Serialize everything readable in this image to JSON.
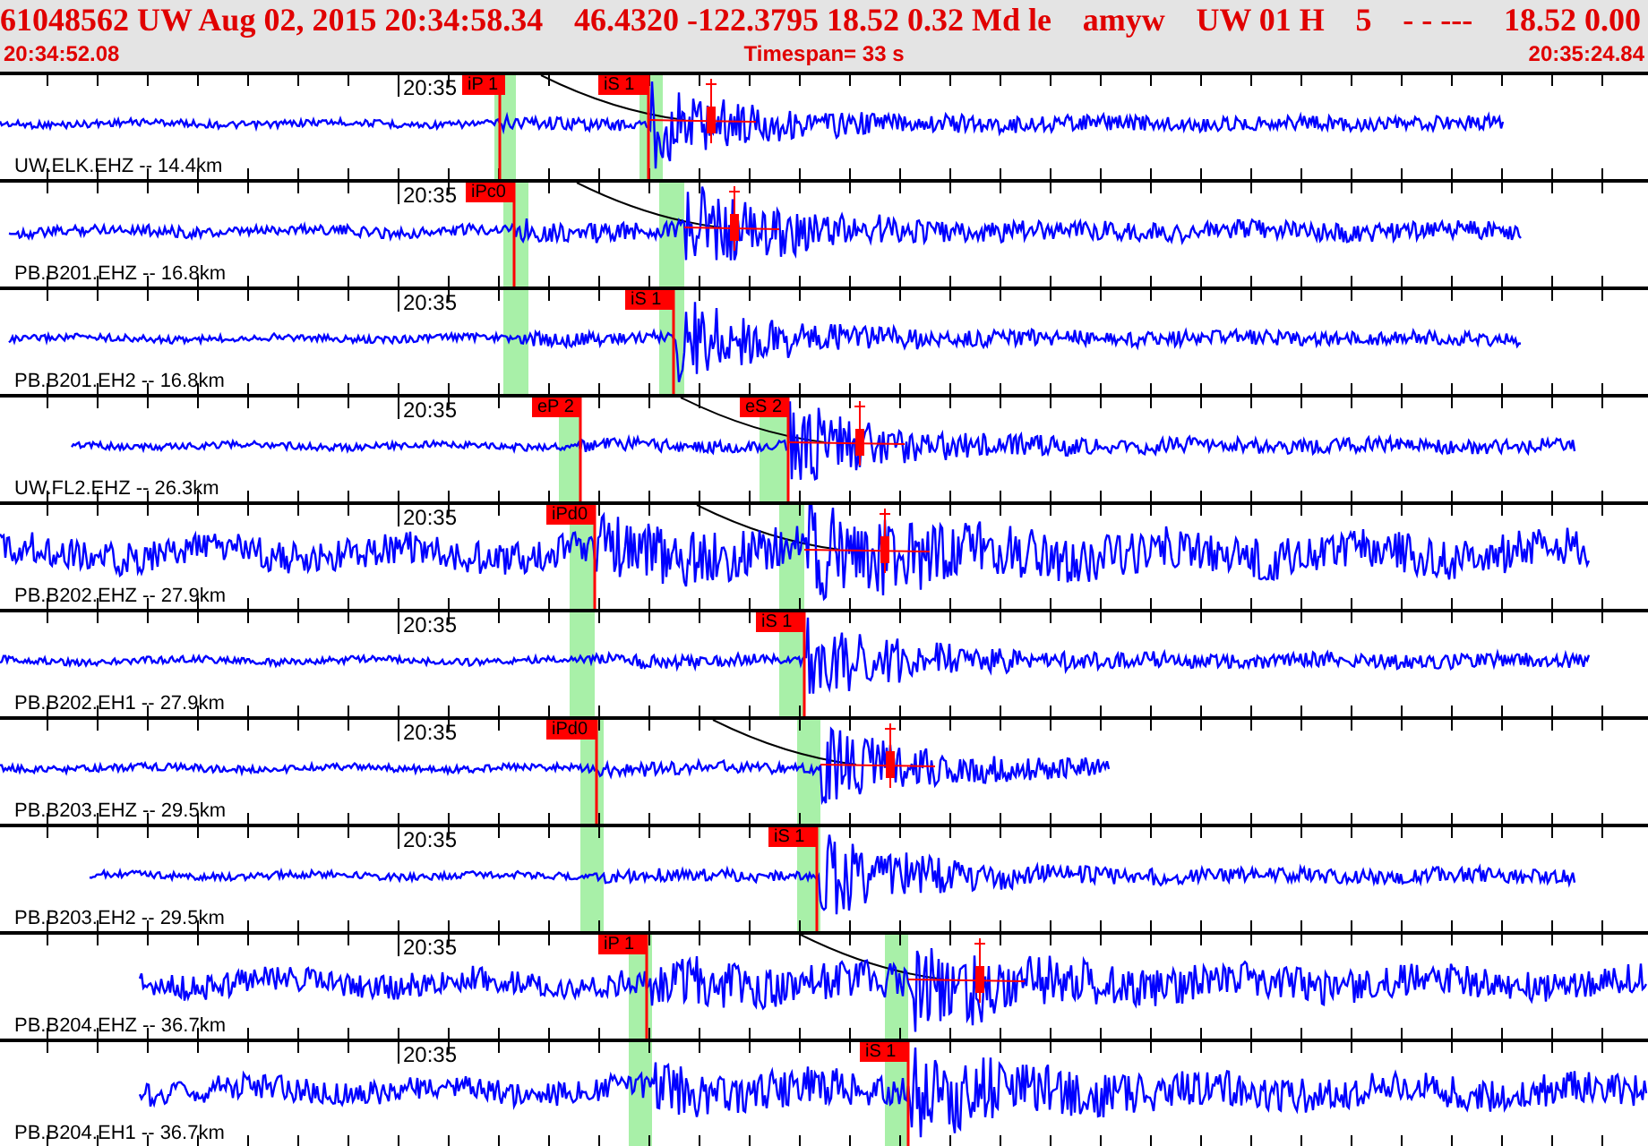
{
  "header": {
    "event_fields": [
      "61048562 UW Aug 02, 2015 20:34:58.34",
      "46.4320 -122.3795 18.52 0.32 Md le",
      "amyw",
      "UW 01 H",
      "5",
      "- - ---",
      "18.52 0.00"
    ],
    "start_time": "20:34:52.08",
    "timespan": "Timespan=  33 s",
    "end_time": "20:35:24.84"
  },
  "traces": [
    {
      "station": "UW.ELK.EHZ -- 14.4km",
      "time_label": "20:35",
      "picks": [
        {
          "label": "iP 1"
        },
        {
          "label": "iS 1"
        }
      ]
    },
    {
      "station": "PB.B201.EHZ -- 16.8km",
      "time_label": "20:35",
      "picks": [
        {
          "label": "iPc0"
        }
      ]
    },
    {
      "station": "PB.B201.EH2 -- 16.8km",
      "time_label": "20:35",
      "picks": [
        {
          "label": "iS 1"
        }
      ]
    },
    {
      "station": "UW.FL2.EHZ -- 26.3km",
      "time_label": "20:35",
      "picks": [
        {
          "label": "eP 2"
        },
        {
          "label": "eS 2"
        }
      ]
    },
    {
      "station": "PB.B202.EHZ -- 27.9km",
      "time_label": "20:35",
      "picks": [
        {
          "label": "iPd0"
        }
      ]
    },
    {
      "station": "PB.B202.EH1 -- 27.9km",
      "time_label": "20:35",
      "picks": [
        {
          "label": "iS 1"
        }
      ]
    },
    {
      "station": "PB.B203.EHZ -- 29.5km",
      "time_label": "20:35",
      "picks": [
        {
          "label": "iPd0"
        }
      ]
    },
    {
      "station": "PB.B203.EH2 -- 29.5km",
      "time_label": "20:35",
      "picks": [
        {
          "label": "iS 1"
        }
      ]
    },
    {
      "station": "PB.B204.EHZ -- 36.7km",
      "time_label": "20:35",
      "picks": [
        {
          "label": "iP 1"
        }
      ]
    },
    {
      "station": "PB.B204.EH1 -- 36.7km",
      "time_label": "20:35",
      "picks": [
        {
          "label": "iS 1"
        }
      ]
    }
  ]
}
